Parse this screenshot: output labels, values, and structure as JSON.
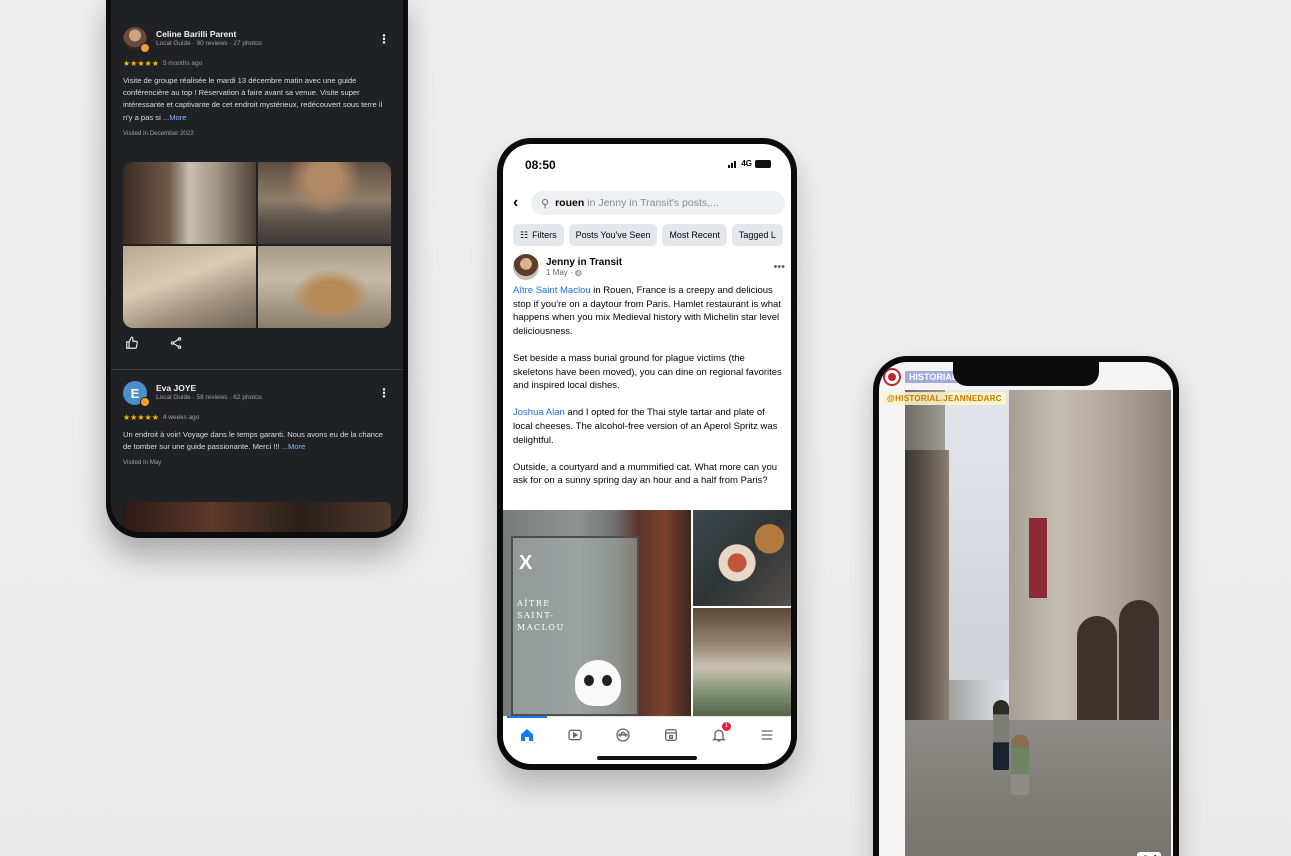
{
  "reviews": [
    {
      "name": "Celine Barilli Parent",
      "meta": "Local Guide · 90 reviews · 27 photos",
      "stars": "★★★★★",
      "time_ago": "5 months ago",
      "text": "Visite de groupe réalisée le mardi 13 décembre matin avec une guide conférencière au top ! Réservation à faire avant sa venue. Visite super intéressante et captivante de cet endroit mystérieux, redécouvert sous terre il n'y a pas si ",
      "more": "...More",
      "visited": "Visited in December 2022"
    },
    {
      "name": "Eva JOYE",
      "avatar_letter": "E",
      "meta": "Local Guide · 58 reviews · 62 photos",
      "stars": "★★★★★",
      "time_ago": "4 weeks ago",
      "text": "Un endroit à voir! Voyage dans le temps garanti. Nous avons eu de la chance de tomber sur une guide passionante. Merci !!! ",
      "more": "...More",
      "visited": "Visited in May"
    }
  ],
  "facebook": {
    "status": {
      "time": "08:50",
      "network": "4G"
    },
    "search": {
      "query": "rouen",
      "rest": "in Jenny in Transit's posts,..."
    },
    "chips": [
      "Filters",
      "Posts You've Seen",
      "Most Recent",
      "Tagged L"
    ],
    "post": {
      "author": "Jenny in Transit",
      "meta": "1 May · ",
      "p1_link": "Aître Saint Maclou",
      "p1_text": " in Rouen, France is a creepy and delicious stop if you're on a daytour from Paris. Hamlet restaurant is what happens when you mix Medieval history with Michelin star level deliciousness.",
      "p2_text": "Set beside a mass burial ground for plague victims (the skeletons have been moved), you can dine on regional favorites and inspired local dishes.",
      "p3_link": "Joshua Alan",
      "p3_text": " and I opted for the Thai style tartar and plate of local cheeses. The alcohol-free version of an Aperol Spritz was delightful.",
      "p4_text": "Outside, a courtyard and a mummified cat. What more can you ask for on a sunny spring day an hour and a half from Paris?"
    },
    "photo_sign": {
      "mark": "X",
      "line1": "AÎTRE",
      "line2": "SAINT-",
      "line3": "MACLOU"
    },
    "notification_count": "1"
  },
  "story": {
    "title": "HISTORIAL JEANNE D'ARC",
    "handle": "@HISTORIAL.JEANNEDARC",
    "ad_label": "Ad"
  },
  "colors": {
    "dark_bg": "#202124",
    "stars": "#fbbc04",
    "link_blue": "#216fdb",
    "fb_blue": "#1877f2"
  }
}
